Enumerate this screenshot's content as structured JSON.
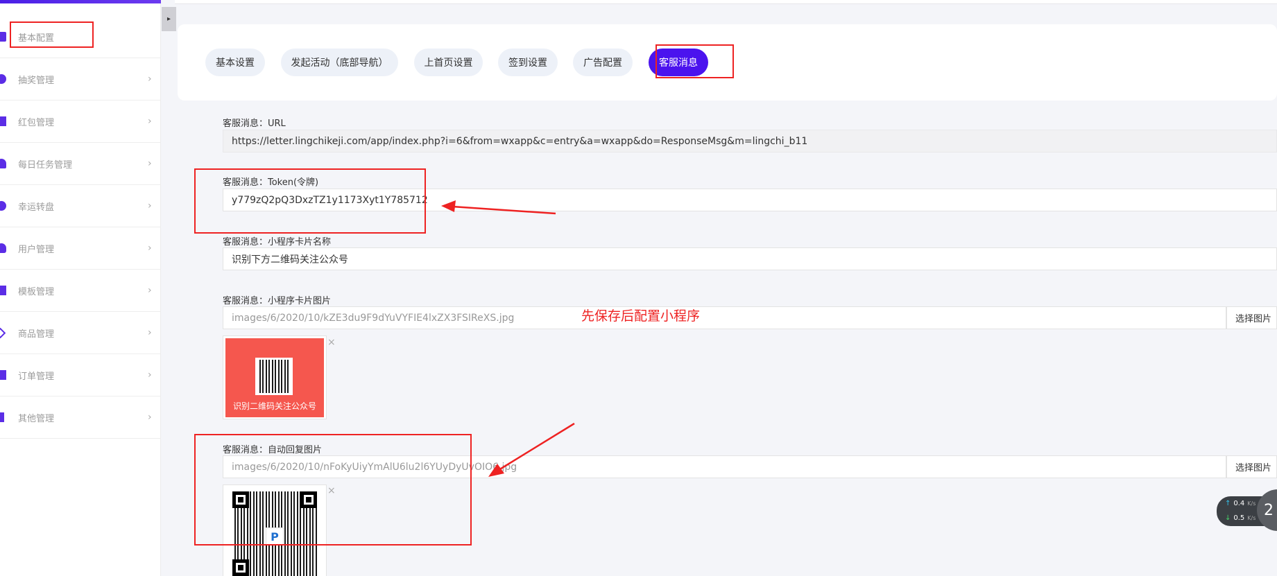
{
  "sidebar": {
    "items": [
      {
        "label": "基本配置",
        "icon": "check-square-icon",
        "chevron": ""
      },
      {
        "label": "抽奖管理",
        "icon": "pie-icon",
        "chevron": "›"
      },
      {
        "label": "红包管理",
        "icon": "red-packet-icon",
        "chevron": "›"
      },
      {
        "label": "每日任务管理",
        "icon": "task-icon",
        "chevron": "›"
      },
      {
        "label": "幸运转盘",
        "icon": "wheel-icon",
        "chevron": "›"
      },
      {
        "label": "用户管理",
        "icon": "user-icon",
        "chevron": "›"
      },
      {
        "label": "模板管理",
        "icon": "template-icon",
        "chevron": "›"
      },
      {
        "label": "商品管理",
        "icon": "goods-icon",
        "chevron": "›"
      },
      {
        "label": "订单管理",
        "icon": "order-icon",
        "chevron": "›"
      },
      {
        "label": "其他管理",
        "icon": "list-icon",
        "chevron": "›"
      }
    ],
    "collapse_glyph": "▸"
  },
  "tabs": [
    {
      "label": "基本设置",
      "active": false
    },
    {
      "label": "发起活动（底部导航）",
      "active": false
    },
    {
      "label": "上首页设置",
      "active": false
    },
    {
      "label": "签到设置",
      "active": false
    },
    {
      "label": "广告配置",
      "active": false
    },
    {
      "label": "客服消息",
      "active": true
    }
  ],
  "form": {
    "url": {
      "label": "客服消息：URL",
      "value": "https://letter.lingchikeji.com/app/index.php?i=6&from=wxapp&c=entry&a=wxapp&do=ResponseMsg&m=lingchi_b11"
    },
    "token": {
      "label": "客服消息：Token(令牌)",
      "value": "y779zQ2pQ3DxzTZ1y1173Xyt1Y785712"
    },
    "card_name": {
      "label": "客服消息：小程序卡片名称",
      "value": "识别下方二维码关注公众号"
    },
    "card_image": {
      "label": "客服消息：小程序卡片图片",
      "value": "images/6/2020/10/kZE3du9F9dYuVYFIE4lxZX3FSIReXS.jpg",
      "button": "选择图片",
      "caption": "识别二维码关注公众号"
    },
    "auto_reply": {
      "label": "客服消息：自动回复图片",
      "value": "images/6/2020/10/nFoKyUiyYmAlU6lu2l6YUyDyUvOIO6.jpg",
      "button": "选择图片"
    },
    "close_glyph": "×"
  },
  "annotation": {
    "note": "先保存后配置小程序",
    "color": "#ee2222"
  },
  "net_widget": {
    "up": "0.4",
    "down": "0.5",
    "unit": "K/s",
    "up_arrow": "↑",
    "down_arrow": "↓",
    "badge": "2"
  },
  "colors": {
    "accent": "#4b13ee",
    "tab_bg": "#edf1f8"
  }
}
